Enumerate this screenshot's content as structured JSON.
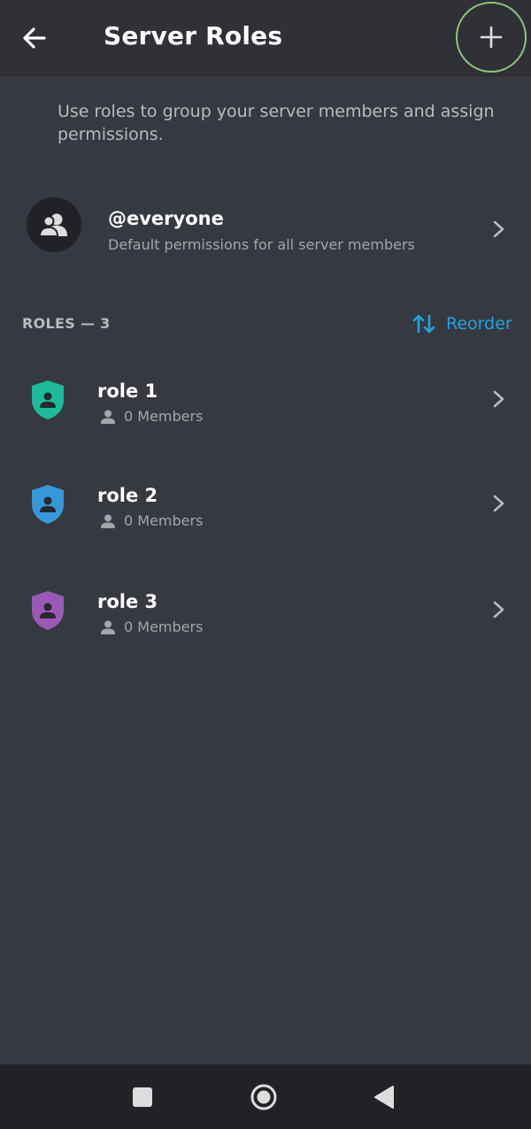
{
  "header": {
    "title": "Server Roles",
    "back_icon": "arrow-left-icon",
    "add_icon": "plus-icon"
  },
  "description": "Use roles to group your server members and assign permissions.",
  "everyone": {
    "name": "@everyone",
    "subtitle": "Default permissions for all server members",
    "icon": "members-icon"
  },
  "roles_section": {
    "header": "ROLES — 3",
    "reorder_label": "Reorder",
    "reorder_icon": "swap-vertical-icon"
  },
  "roles": [
    {
      "name": "role 1",
      "members": "0 Members",
      "color": "#1abc9c"
    },
    {
      "name": "role 2",
      "members": "0 Members",
      "color": "#3498db"
    },
    {
      "name": "role 3",
      "members": "0 Members",
      "color": "#9b59b6"
    }
  ],
  "navbar": {
    "recents_icon": "square-icon",
    "home_icon": "circle-icon",
    "back_icon": "triangle-back-icon"
  },
  "colors": {
    "background": "#36393f",
    "header": "#2f3136",
    "accent": "#1fa3e6",
    "highlight_ring": "#8fc878"
  }
}
